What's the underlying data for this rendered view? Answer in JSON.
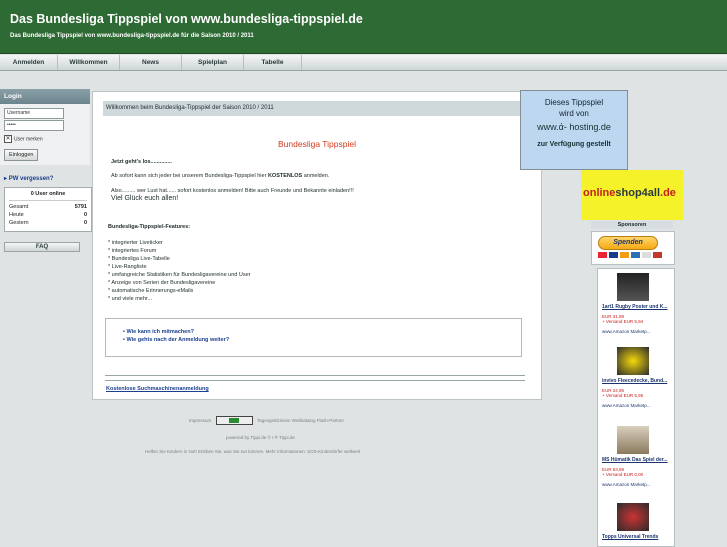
{
  "header": {
    "title": "Das Bundesliga Tippspiel von www.bundesliga-tippspiel.de",
    "subtitle": "Das Bundesliga Tippspiel von www.bundesliga-tippspiel.de für die Saison 2010 / 2011"
  },
  "nav": {
    "items": [
      "Anmelden",
      "Willkommen",
      "News",
      "Spielplan",
      "Tabelle"
    ]
  },
  "login": {
    "heading": "Login",
    "username_value": "Username",
    "password_value": "•••••",
    "remember_label": "User merken",
    "button": "Einloggen",
    "pw_link": "PW vergessen?"
  },
  "stats": {
    "online": "0 User online",
    "rows": [
      {
        "label": "Gesamt",
        "value": "5791"
      },
      {
        "label": "Heute",
        "value": "0"
      },
      {
        "label": "Gestern",
        "value": "0"
      }
    ],
    "faq": "FAQ"
  },
  "main": {
    "welcome": "Willkommen beim Bundesliga-Tippspiel der Saison 2010 / 2011",
    "card_title": "Bundesliga Tippspiel",
    "intro_heading": "Jetzt geht's los..............",
    "intro_line1_pre": "Ab sofort kann sich jeder bei unserem Bundesliga-Tippspiel hier ",
    "intro_line1_bold": "KOSTENLOS",
    "intro_line1_post": " anmelden.",
    "intro_line2": "Also......... wer Lust hat...... sofort kostenlos anmelden! Bitte auch Freunde und  Bekannte einladen!!!",
    "intro_line3": "Viel Glück euch allen!",
    "features_heading": "Bundesliga-Tippspiel-Features:",
    "features": [
      "* integrierter Liveticker",
      "* integriertes Forum",
      "* Bundesliga Live-Tabelle",
      "* Live-Rangliste",
      "* umfangreiche Statistiken für Bundesligavereine und User",
      "* Anzeige von Serien der Bundesligavereine",
      "* automatische Erinnerungs-eMails",
      "* und viele mehr..."
    ],
    "links": [
      "Wie kann ich mitmachen?",
      "Wie gehts nach der Anmeldung weiter?"
    ],
    "seo_link": "Kostenlose Suchmaschinenanmeldung"
  },
  "footer": {
    "impressum": "Impressum",
    "partner": "Tagesgeldzinsen Webkatalog Flash-Partner",
    "powered": "powered by Tippi.de © I ® Tippi.de",
    "charity": "Helfen Sie Kindern in Not! Erleben Sie, was Sie tun können. Mehr Informationen: SOS-Kinderdörfer weltweit"
  },
  "ads": {
    "hosting_line1": "Dieses Tippspiel",
    "hosting_line2": "wird von",
    "hosting_domain": "www.ά- hosting.de",
    "hosting_line3": "zur Verfügung gestellt",
    "shop_name_pre": "online",
    "shop_name_mid": "shop4all",
    "shop_name_post": ".de",
    "sponsors": "Sponsoren",
    "spenden": "Spenden"
  },
  "products": [
    {
      "title": "1art1 Rugby Poster und K...",
      "price": "EUR 31,99",
      "ship": "+ Versand EUR 5,94",
      "amazon": "www.Amazon Marketp..."
    },
    {
      "title": "invivo Fleecedecke, Bund...",
      "price": "EUR 24,95",
      "ship": "+ Versand EUR 5,95",
      "amazon": "www.Amazon Marketp..."
    },
    {
      "title": "MS Hümatik Das Spiel der...",
      "price": "EUR 63,99",
      "ship": "+ Versand EUR 0,00",
      "amazon": "www.Amazon Marketp..."
    },
    {
      "title": "Topps Universal Trends",
      "price": "",
      "ship": "",
      "amazon": ""
    }
  ],
  "colors": {
    "header": "#2d6a34",
    "accent_title": "#d23b1c",
    "link": "#1a3f8c"
  }
}
